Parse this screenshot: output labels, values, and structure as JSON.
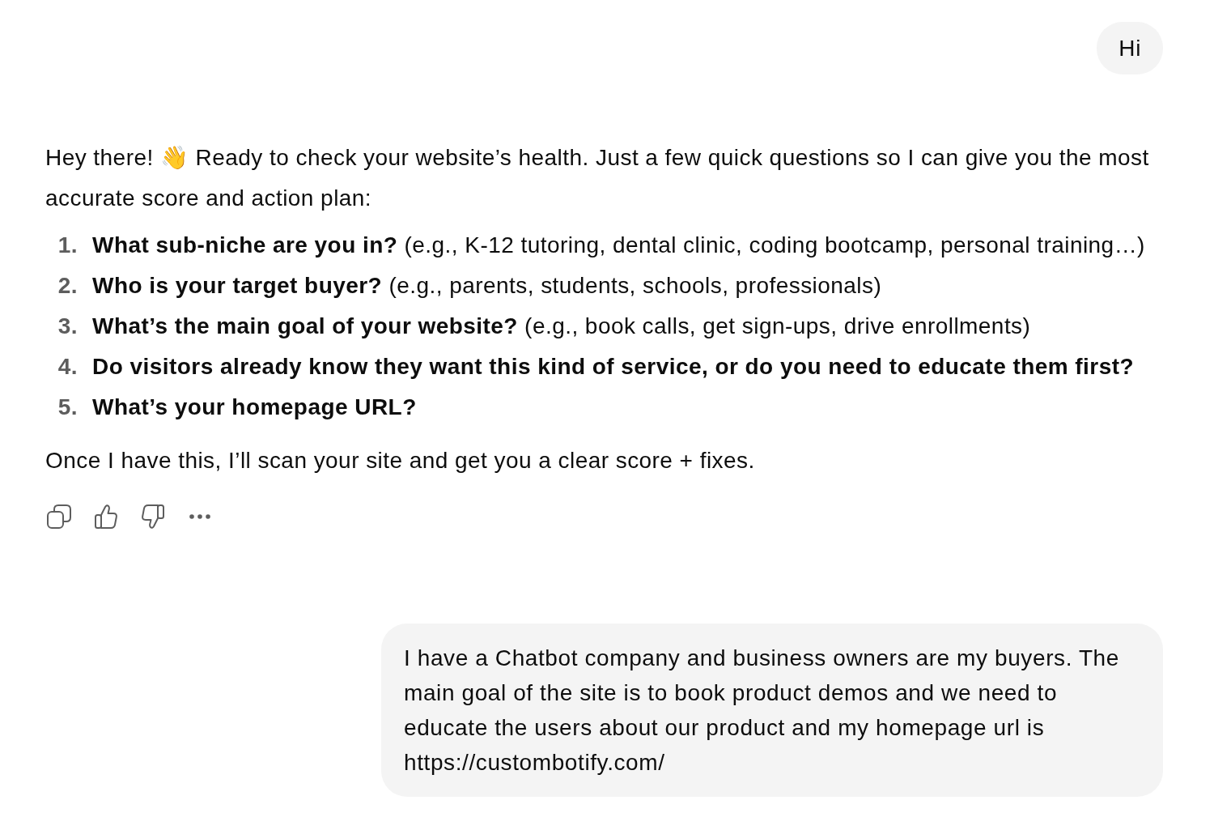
{
  "messages": [
    {
      "kind": "user",
      "text": "Hi"
    },
    {
      "kind": "assistant",
      "intro": "Hey there! 👋 Ready to check your website’s health. Just a few quick questions so I can give you the most accurate score and action plan:",
      "questions": [
        {
          "number": "1.",
          "question": "What sub-niche are you in?",
          "example": "(e.g., K-12 tutoring, dental clinic, coding bootcamp, personal training…)"
        },
        {
          "number": "2.",
          "question": "Who is your target buyer?",
          "example": "(e.g., parents, students, schools, professionals)"
        },
        {
          "number": "3.",
          "question": "What’s the main goal of your website?",
          "example": "(e.g., book calls, get sign-ups, drive enrollments)"
        },
        {
          "number": "4.",
          "question": "Do visitors already know they want this kind of service, or do you need to educate them first?"
        },
        {
          "number": "5.",
          "question": "What’s your homepage URL?"
        }
      ],
      "closing": "Once I have this, I’ll scan your site and get you a clear score + fixes."
    },
    {
      "kind": "user",
      "text": "I have a Chatbot company and business owners are my buyers. The main goal of the site is to book product demos and we need to educate the users about our product and my homepage url is https://custombotify.com/"
    }
  ]
}
